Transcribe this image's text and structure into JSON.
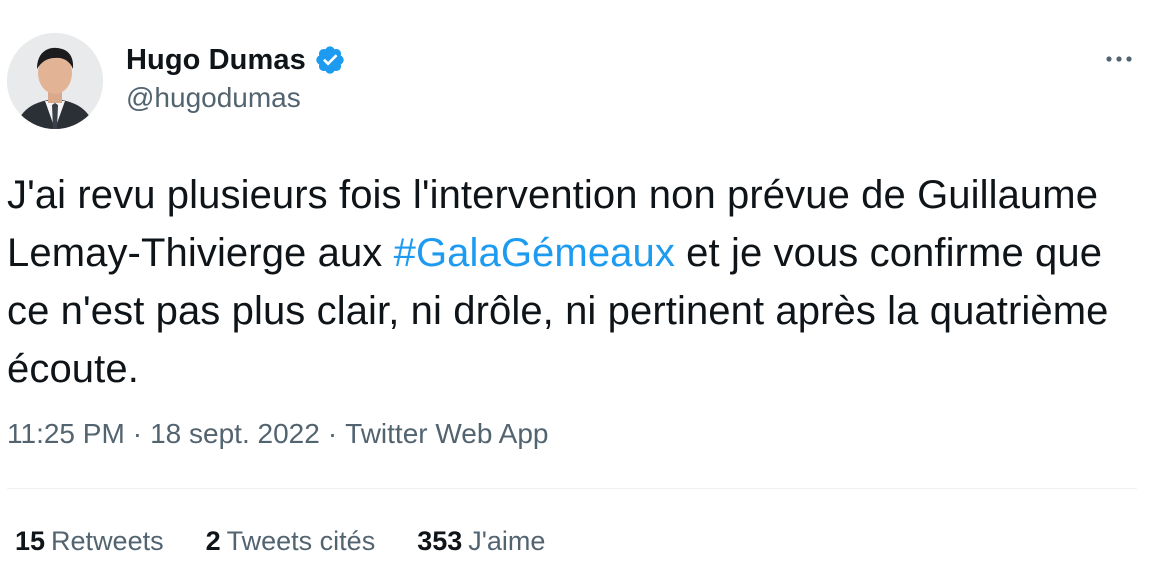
{
  "author": {
    "display_name": "Hugo Dumas",
    "handle": "@hugodumas",
    "verified": true
  },
  "tweet": {
    "text_before": "J'ai revu plusieurs fois l'intervention non prévue de Guillaume Lemay-Thivierge aux ",
    "hashtag": "#GalaGémeaux",
    "text_after": " et je vous confirme que ce n'est pas plus clair, ni drôle, ni pertinent après la quatrième écoute."
  },
  "meta": {
    "time": "11:25 PM",
    "separator": "·",
    "date": "18 sept. 2022",
    "source": "Twitter Web App"
  },
  "stats": {
    "retweets": {
      "count": "15",
      "label": "Retweets"
    },
    "quotes": {
      "count": "2",
      "label": "Tweets cités"
    },
    "likes": {
      "count": "353",
      "label": "J'aime"
    }
  },
  "colors": {
    "accent": "#1d9bf0",
    "text": "#0f1419",
    "secondary": "#536471",
    "divider": "#eff3f4"
  },
  "icons": {
    "verified": "verified-badge-icon",
    "more": "more-options-icon"
  }
}
